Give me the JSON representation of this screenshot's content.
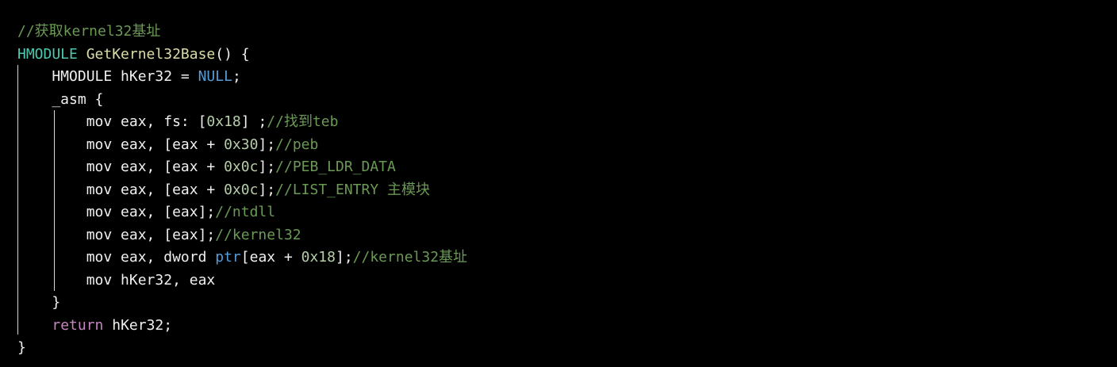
{
  "code": {
    "lines": [
      [
        {
          "t": "//获取kernel32基址",
          "c": "comment"
        }
      ],
      [
        {
          "t": "HMODULE",
          "c": "type"
        },
        {
          "t": " ",
          "c": "plain"
        },
        {
          "t": "GetKernel32Base",
          "c": "func"
        },
        {
          "t": "() {",
          "c": "plain"
        }
      ],
      [
        {
          "t": "    HMODULE hKer32 = ",
          "c": "plain"
        },
        {
          "t": "NULL",
          "c": "const"
        },
        {
          "t": ";",
          "c": "plain"
        }
      ],
      [
        {
          "t": "    _asm {",
          "c": "plain"
        }
      ],
      [
        {
          "t": "        mov eax, fs: [",
          "c": "plain"
        },
        {
          "t": "0x18",
          "c": "num"
        },
        {
          "t": "] ;",
          "c": "plain"
        },
        {
          "t": "//找到teb",
          "c": "comment"
        }
      ],
      [
        {
          "t": "        mov eax, [eax + ",
          "c": "plain"
        },
        {
          "t": "0x30",
          "c": "num"
        },
        {
          "t": "];",
          "c": "plain"
        },
        {
          "t": "//peb",
          "c": "comment"
        }
      ],
      [
        {
          "t": "        mov eax, [eax + ",
          "c": "plain"
        },
        {
          "t": "0x0c",
          "c": "num"
        },
        {
          "t": "];",
          "c": "plain"
        },
        {
          "t": "//PEB_LDR_DATA",
          "c": "comment"
        }
      ],
      [
        {
          "t": "        mov eax, [eax + ",
          "c": "plain"
        },
        {
          "t": "0x0c",
          "c": "num"
        },
        {
          "t": "];",
          "c": "plain"
        },
        {
          "t": "//LIST_ENTRY 主模块",
          "c": "comment"
        }
      ],
      [
        {
          "t": "        mov eax, [eax];",
          "c": "plain"
        },
        {
          "t": "//ntdll",
          "c": "comment"
        }
      ],
      [
        {
          "t": "        mov eax, [eax];",
          "c": "plain"
        },
        {
          "t": "//kernel32",
          "c": "comment"
        }
      ],
      [
        {
          "t": "        mov eax, dword ",
          "c": "plain"
        },
        {
          "t": "ptr",
          "c": "const"
        },
        {
          "t": "[eax + ",
          "c": "plain"
        },
        {
          "t": "0x18",
          "c": "num"
        },
        {
          "t": "];",
          "c": "plain"
        },
        {
          "t": "//kernel32基址",
          "c": "comment"
        }
      ],
      [
        {
          "t": "        mov hKer32, eax",
          "c": "plain"
        }
      ],
      [
        {
          "t": "    }",
          "c": "plain"
        }
      ],
      [
        {
          "t": "    ",
          "c": "plain"
        },
        {
          "t": "return",
          "c": "kw"
        },
        {
          "t": " hKer32;",
          "c": "plain"
        }
      ],
      [
        {
          "t": "}",
          "c": "plain"
        }
      ]
    ]
  }
}
